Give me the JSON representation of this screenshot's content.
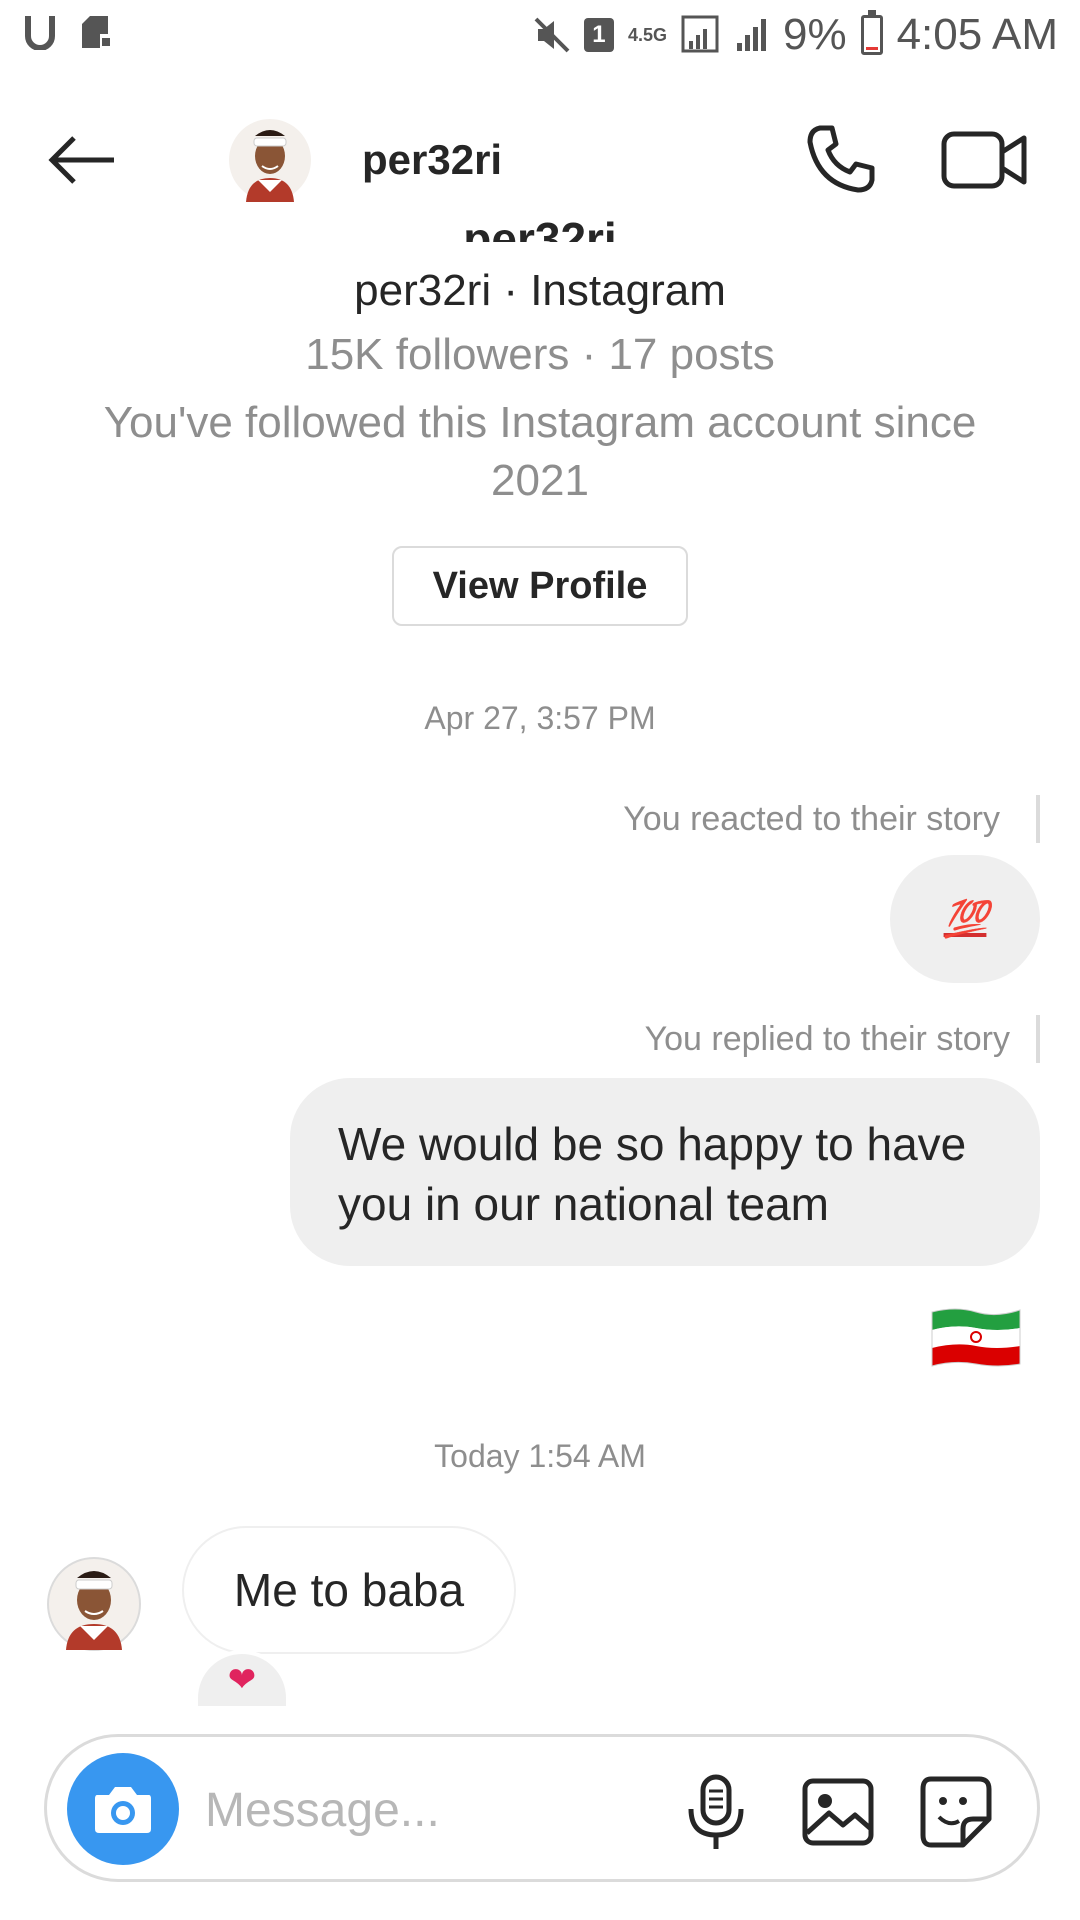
{
  "status_bar": {
    "network_label": "4.5G",
    "sim_label": "1",
    "battery": "9%",
    "time": "4:05 AM"
  },
  "header": {
    "username": "per32ri"
  },
  "profile": {
    "handle_line": "per32ri · Instagram",
    "stats": "15K followers · 17 posts",
    "follow_since": "You've followed this Instagram account since 2021",
    "view_profile_label": "View Profile"
  },
  "messages": {
    "timestamp_1": "Apr 27, 3:57 PM",
    "reaction_note": "You reacted to their story",
    "reaction_emoji": "💯",
    "reply_note": "You replied to their story",
    "reply_text": "We would be so happy to have you in our national team",
    "timestamp_2": "Today 1:54 AM",
    "incoming_text": "Me to baba",
    "incoming_reaction": "❤"
  },
  "composer": {
    "placeholder": "Message..."
  },
  "colors": {
    "accent_blue": "#3897f0",
    "bubble_gray": "#efefef",
    "muted_text": "#8e8e8e",
    "heart_red": "#e0245e"
  },
  "icons": {
    "back": "back-arrow-icon",
    "call": "phone-icon",
    "video": "video-camera-icon",
    "camera": "camera-icon",
    "mic": "microphone-icon",
    "gallery": "gallery-icon",
    "sticker": "sticker-icon",
    "flag": "iran-flag-icon"
  }
}
